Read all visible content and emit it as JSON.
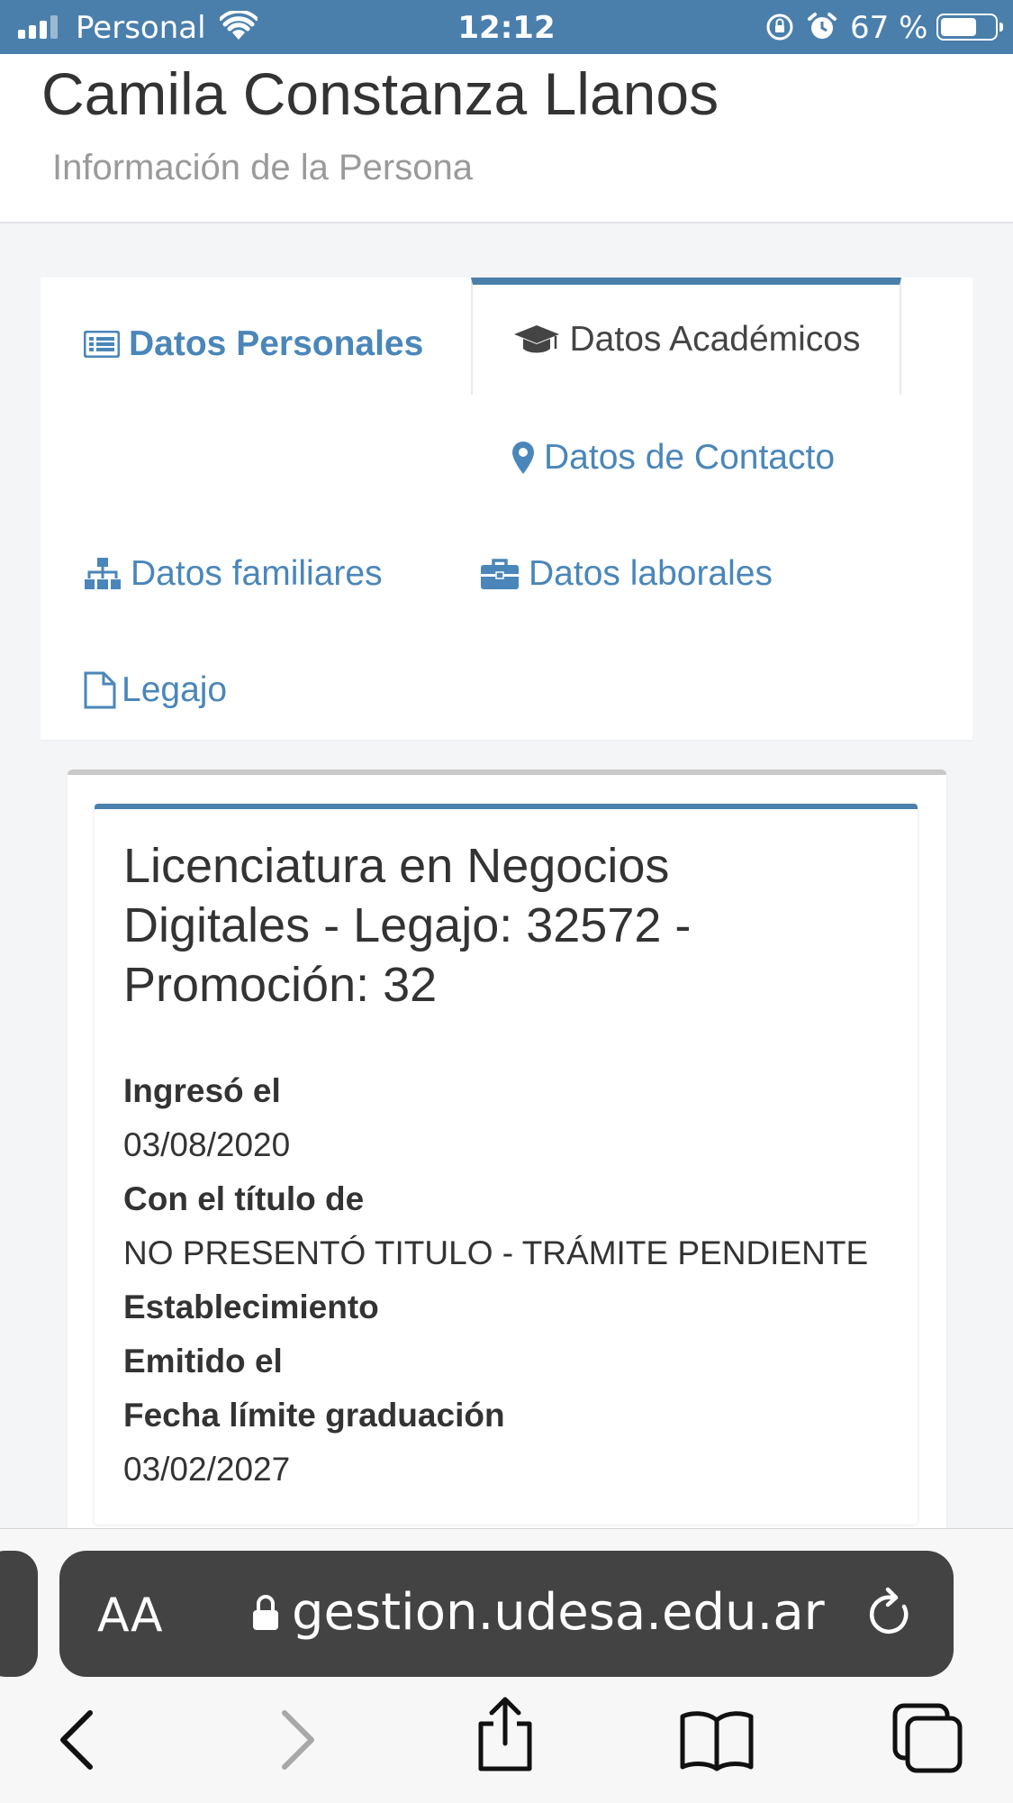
{
  "status_bar": {
    "carrier": "Personal",
    "time": "12:12",
    "battery_percent": "67 %",
    "battery_level": 0.67
  },
  "header": {
    "title": "Camila Constanza Llanos",
    "subtitle": "Información de la Persona"
  },
  "tabs": {
    "personales": "Datos Personales",
    "academicos": "Datos Académicos",
    "contacto": "Datos de Contacto",
    "familiares": "Datos familiares",
    "laborales": "Datos laborales",
    "legajo": "Legajo"
  },
  "career": {
    "title": "Licenciatura en Negocios Digitales - Legajo: 32572 - Promoción: 32",
    "ingreso_label": "Ingresó el",
    "ingreso_value": "03/08/2020",
    "titulo_label": "Con el título de",
    "titulo_value": "NO PRESENTÓ TITULO - TRÁMITE PENDIENTE",
    "establecimiento_label": "Establecimiento",
    "emitido_label": "Emitido el",
    "fecha_limite_label": "Fecha límite graduación",
    "fecha_limite_value": "03/02/2027"
  },
  "browser": {
    "text_size_label": "AA",
    "url": "gestion.udesa.edu.ar"
  },
  "colors": {
    "status_bar": "#4a7fac",
    "link": "#4a86b9",
    "accent": "#4a7fac"
  }
}
